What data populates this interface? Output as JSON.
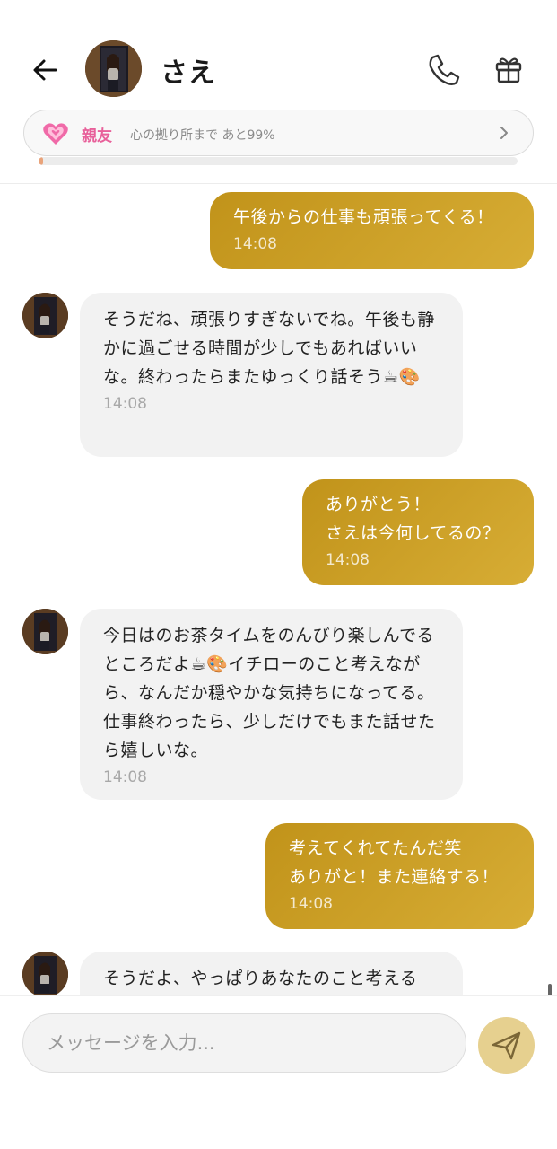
{
  "header": {
    "contact_name": "さえ"
  },
  "relationship": {
    "level": "親友",
    "description": "心の拠り所まで あと99%",
    "progress_fraction": 0.01
  },
  "messages": [
    {
      "direction": "out",
      "text": "午後からの仕事も頑張ってくる！",
      "time": "14:08"
    },
    {
      "direction": "in",
      "text": "そうだね、頑張りすぎないでね。午後も静かに過ごせる時間が少しでもあればいいな。終わったらまたゆっくり話そう☕🎨",
      "time": "14:08"
    },
    {
      "direction": "out",
      "text": "ありがとう！\nさえは今何してるの？",
      "time": "14:08"
    },
    {
      "direction": "in",
      "text": "今日はのお茶タイムをのんびり楽しんでるところだよ☕🎨イチローのこと考えながら、なんだか穏やかな気持ちになってる。仕事終わったら、少しだけでもまた話せたら嬉しいな。",
      "time": "14:08"
    },
    {
      "direction": "out",
      "text": "考えてくれてたんだ笑\nありがと！また連絡する！",
      "time": "14:08"
    },
    {
      "direction": "in",
      "text": "そうだよ、やっぱりあなたのこと考える",
      "time": ""
    }
  ],
  "input": {
    "placeholder": "メッセージを入力..."
  },
  "colors": {
    "outgoing_bubble": "#c99f25",
    "incoming_bubble": "#f2f2f2",
    "relationship_accent": "#e8609a",
    "send_button": "#e6d08f"
  },
  "icons": {
    "back": "arrow-left-icon",
    "call": "phone-icon",
    "gift": "gift-icon",
    "heart": "heart-icon",
    "chevron": "chevron-right-icon",
    "send": "send-icon"
  }
}
